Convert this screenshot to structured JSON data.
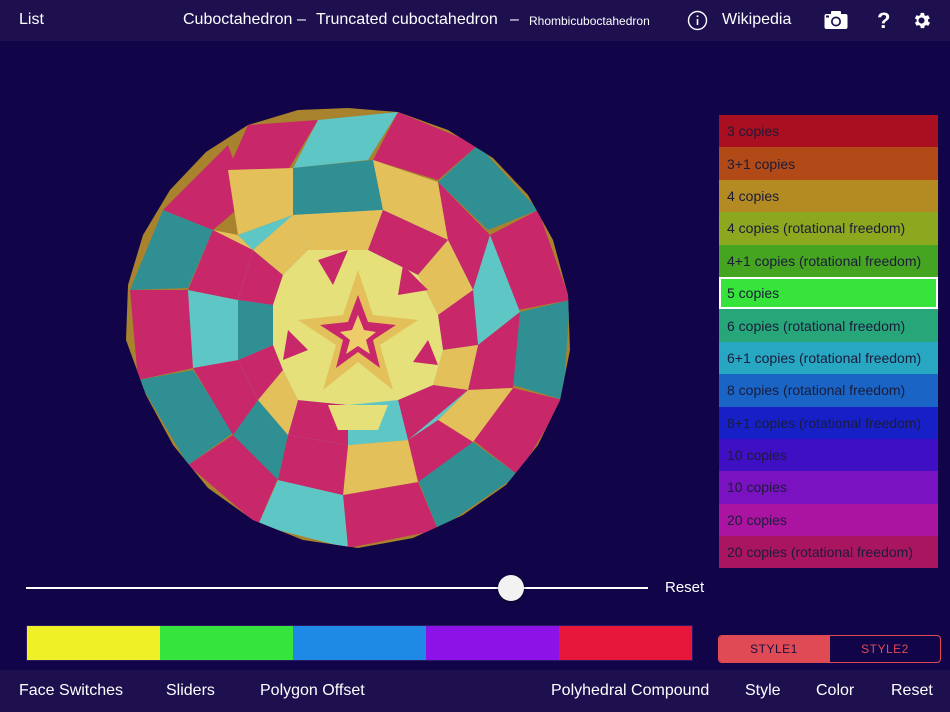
{
  "topbar": {
    "list_label": "List",
    "poly1": "Cuboctahedron",
    "sep": "–",
    "poly2": "Truncated cuboctahedron",
    "poly3": "Rhombicuboctahedron",
    "wikipedia_label": "Wikipedia",
    "info_icon": "info-icon",
    "camera_icon": "camera-icon",
    "help_glyph": "?",
    "settings_icon": "gear-icon"
  },
  "legend": {
    "items": [
      {
        "label": "3 copies",
        "color": "#a90f20"
      },
      {
        "label": "3+1 copies",
        "color": "#b14a17"
      },
      {
        "label": "4 copies",
        "color": "#b38b22"
      },
      {
        "label": "4 copies (rotational freedom)",
        "color": "#8ca81e"
      },
      {
        "label": "4+1 copies (rotational freedom)",
        "color": "#45a521"
      },
      {
        "label": "5 copies",
        "color": "#36e43c"
      },
      {
        "label": "6 copies (rotational freedom)",
        "color": "#27a779"
      },
      {
        "label": "6+1 copies (rotational freedom)",
        "color": "#28a7c2"
      },
      {
        "label": "8 copies (rotational freedom)",
        "color": "#1a64c5"
      },
      {
        "label": "8+1 copies (rotational freedom)",
        "color": "#1620c6"
      },
      {
        "label": "10 copies",
        "color": "#3f0fc4"
      },
      {
        "label": "10 copies",
        "color": "#7a12c2"
      },
      {
        "label": "20 copies",
        "color": "#ab14a0"
      },
      {
        "label": "20 copies (rotational freedom)",
        "color": "#aa1560"
      }
    ],
    "selected_index": 5
  },
  "slider": {
    "value": 0.78,
    "reset_label": "Reset"
  },
  "swatches": [
    "#f0f026",
    "#35e53d",
    "#1e8ae6",
    "#8d12e8",
    "#e6173a"
  ],
  "style_toggle": {
    "style1": "STYLE1",
    "style2": "STYLE2",
    "active": "STYLE1"
  },
  "bottombar": {
    "face_switches": "Face Switches",
    "sliders": "Sliders",
    "polygon_offset": "Polygon Offset",
    "polyhedral_compound": "Polyhedral Compound",
    "style": "Style",
    "color": "Color",
    "reset": "Reset"
  },
  "polyhedron_colors": [
    "#e3c05a",
    "#c8276a",
    "#2f8f93",
    "#5fc6c6",
    "#b8862b",
    "#eccd6a",
    "#e6e07a"
  ]
}
